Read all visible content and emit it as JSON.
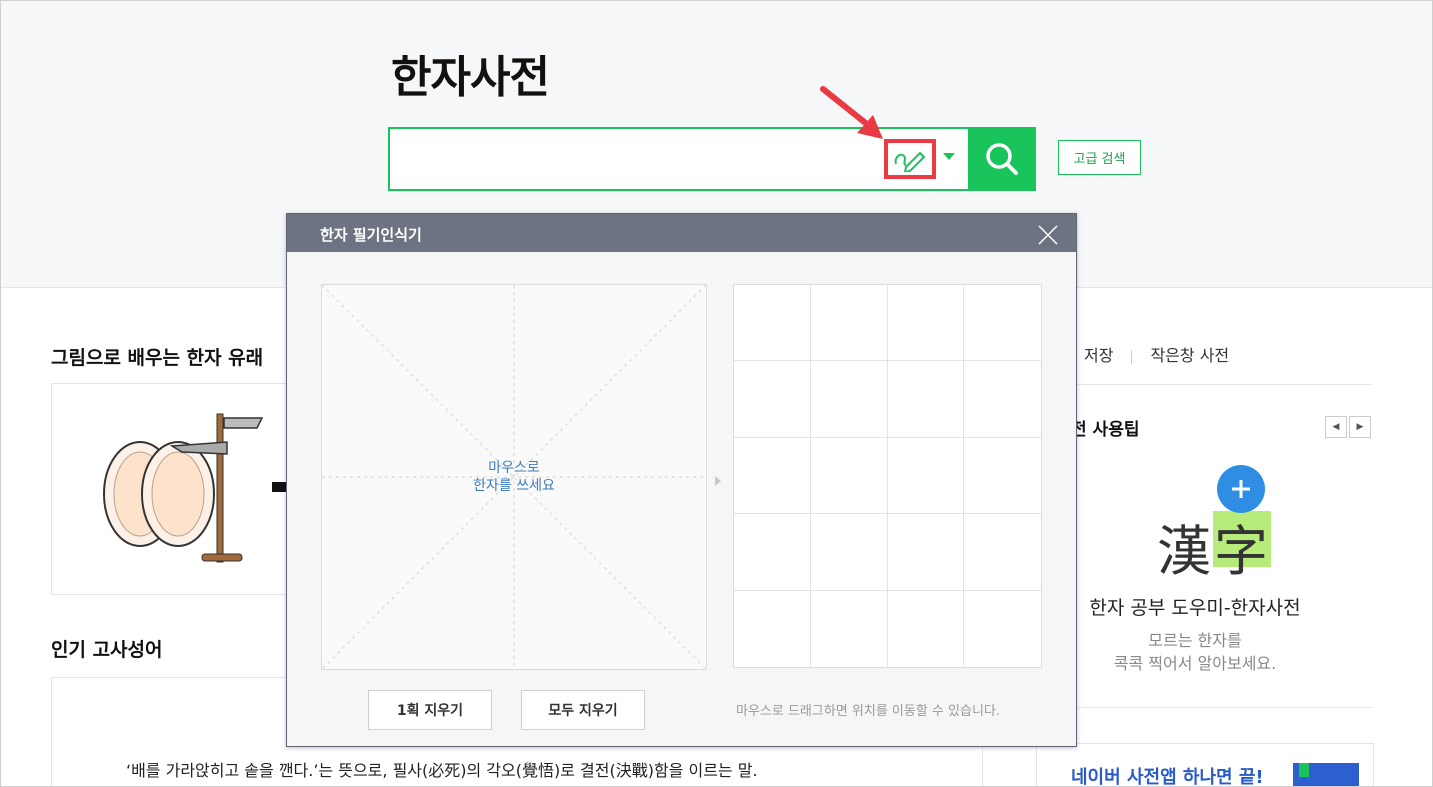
{
  "header": {
    "title": "한자사전",
    "search_placeholder": "",
    "advanced_search_label": "고급 검색"
  },
  "sections": {
    "origins_title": "그림으로 배우는 한자 유래",
    "idioms_title": "인기 고사성어",
    "idiom_quote": "‘배를 가라앉히고 솥을 깬다.’는 뜻으로, 필사(必死)의 각오(覺悟)로 결전(決戰)함을 이르는 말."
  },
  "right_panel": {
    "link_partial": "저장",
    "link_mini_dictionary": "작은창 사전",
    "tip_title_partial": "전 사용팁",
    "logo_chars": [
      "漢",
      "字"
    ],
    "tip_headline": "한자 공부 도우미-한자사전",
    "tip_desc_line1": "모르는 한자를",
    "tip_desc_line2": "콕콕 찍어서 알아보세요.",
    "app_promo": "네이버 사전앱 하나면 끝!"
  },
  "handwriting_popup": {
    "title": "한자 필기인식기",
    "hint_line1": "마우스로",
    "hint_line2": "한자를 쓰세요",
    "erase_one_label": "1획 지우기",
    "erase_all_label": "모두 지우기",
    "drag_note": "마우스로 드래그하면 위치를 이동할 수 있습니다."
  },
  "colors": {
    "accent_green": "#19c45b",
    "highlight_red": "#ea3a44",
    "popup_header": "#6d7382",
    "link_blue": "#2a59c8"
  },
  "icons": {
    "handwriting": "pen-icon",
    "search": "search-icon",
    "close": "close-icon"
  }
}
